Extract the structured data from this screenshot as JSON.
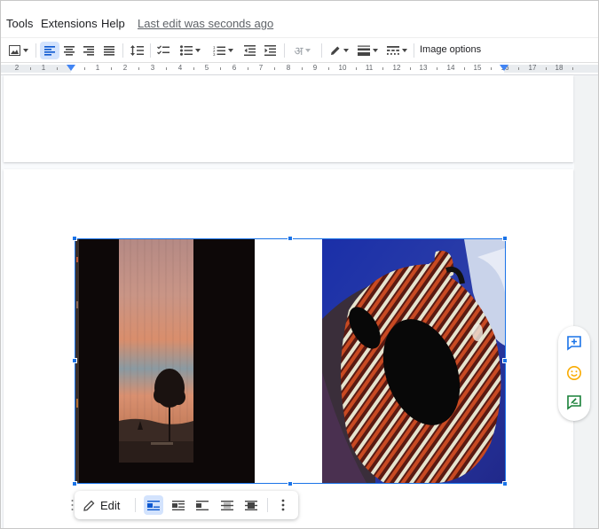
{
  "menu": {
    "items": [
      {
        "label": "Tools"
      },
      {
        "label": "Extensions"
      },
      {
        "label": "Help"
      }
    ],
    "last_edit": "Last edit was seconds ago"
  },
  "toolbar": {
    "image_options_label": "Image options",
    "input_tools_glyph": "अ",
    "buttons": [
      "insert-image",
      "align-left",
      "align-center",
      "align-right",
      "justify",
      "line-spacing",
      "checklist",
      "bulleted-list",
      "numbered-list",
      "decrease-indent",
      "increase-indent",
      "input-tools",
      "border-color",
      "border-weight",
      "border-dash",
      "image-options"
    ],
    "active_button": "align-left"
  },
  "ruler": {
    "numbers": [
      "2",
      "1",
      "1",
      "2",
      "3",
      "4",
      "5",
      "6",
      "7",
      "8",
      "9",
      "10",
      "11",
      "12",
      "13",
      "14",
      "15",
      "16",
      "17",
      "18"
    ]
  },
  "image_toolbar": {
    "edit_label": "Edit",
    "wrap_modes": [
      "in-line",
      "wrap-text",
      "break-text",
      "behind-text",
      "in-front-of-text"
    ],
    "active_wrap_mode": "in-line"
  },
  "side_actions": [
    "add-comment",
    "add-emoji-reaction",
    "suggest-edits"
  ],
  "colors": {
    "accent": "#1a73e8",
    "active_background": "#d3e3fd",
    "side_icon_blue": "#1a73e8",
    "side_icon_yellow": "#f9ab00",
    "side_icon_green": "#188038"
  }
}
